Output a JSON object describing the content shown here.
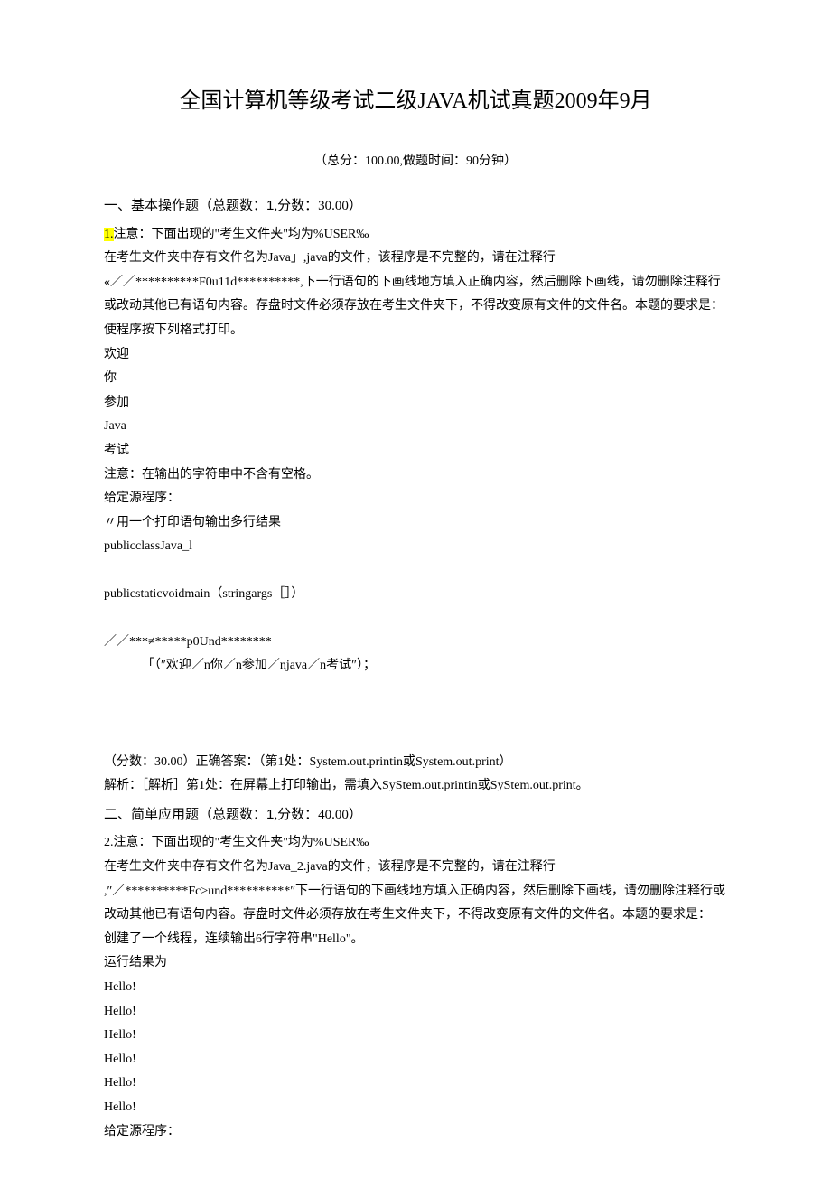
{
  "title": "全国计算机等级考试二级JAVA机试真题2009年9月",
  "subtitle": "（总分：100.00,做题时间：90分钟）",
  "section1": {
    "header_prefix": "一、基本操作题（总题数：",
    "header_count": "1",
    "header_suffix": ",分数：30.00）",
    "q1_num": "1.",
    "q1_l1": "注意：下面出现的\"考生文件夹\"均为%USER‰",
    "q1_l2": "在考生文件夹中存有文件名为Java」,java的文件，该程序是不完整的，请在注释行",
    "q1_l3": "«／／**********F0u11d**********,下一行语句的下画线地方填入正确内容，然后删除下画线，请勿删除注释行或改动其他已有语句内容。存盘时文件必须存放在考生文件夹下，不得改变原有文件的文件名。本题的要求是：",
    "q1_l4": "使程序按下列格式打印。",
    "q1_l5": "欢迎",
    "q1_l6": "你",
    "q1_l7": "参加",
    "q1_l8": "Java",
    "q1_l9": "考试",
    "q1_l10": "注意：在输出的字符串中不含有空格。",
    "q1_l11": "给定源程序：",
    "q1_l12": "〃用一个打印语句输出多行结果",
    "q1_l13": "publicclassJava_l",
    "q1_l14": "publicstaticvoidmain（stringargs［］）",
    "q1_l15": "／／***≠*****p0Und********",
    "q1_l16": "「（″欢迎／n你／n参加／njava／n考试″）；",
    "q1_ans": "（分数：30.00）正确答案：（第1处：System.out.printin或System.out.print）",
    "q1_exp": "解析：［解析］第1处：在屏幕上打印输出，需填入SyStem.out.printin或SyStem.out.print。"
  },
  "section2": {
    "header_prefix": "二、简单应用题（总题数：",
    "header_count": "1",
    "header_suffix": ",分数：40.00）",
    "q2_l1": "2.注意：下面出现的\"考生文件夹\"均为%USER‰",
    "q2_l2": "在考生文件夹中存有文件名为Java_2.java的文件，该程序是不完整的，请在注释行",
    "q2_l3": ",″／**********Fc>und**********″下一行语句的下画线地方填入正确内容，然后删除下画线，请勿删除注释行或改动其他已有语句内容。存盘时文件必须存放在考生文件夹下，不得改变原有文件的文件名。本题的要求是：",
    "q2_l4": "创建了一个线程，连续输出6行字符串\"Hello\"。",
    "q2_l5": "运行结果为",
    "q2_l6": "Hello!",
    "q2_l7": "Hello!",
    "q2_l8": "Hello!",
    "q2_l9": "Hello!",
    "q2_l10": "Hello!",
    "q2_l11": "Hello!",
    "q2_l12": "给定源程序："
  }
}
